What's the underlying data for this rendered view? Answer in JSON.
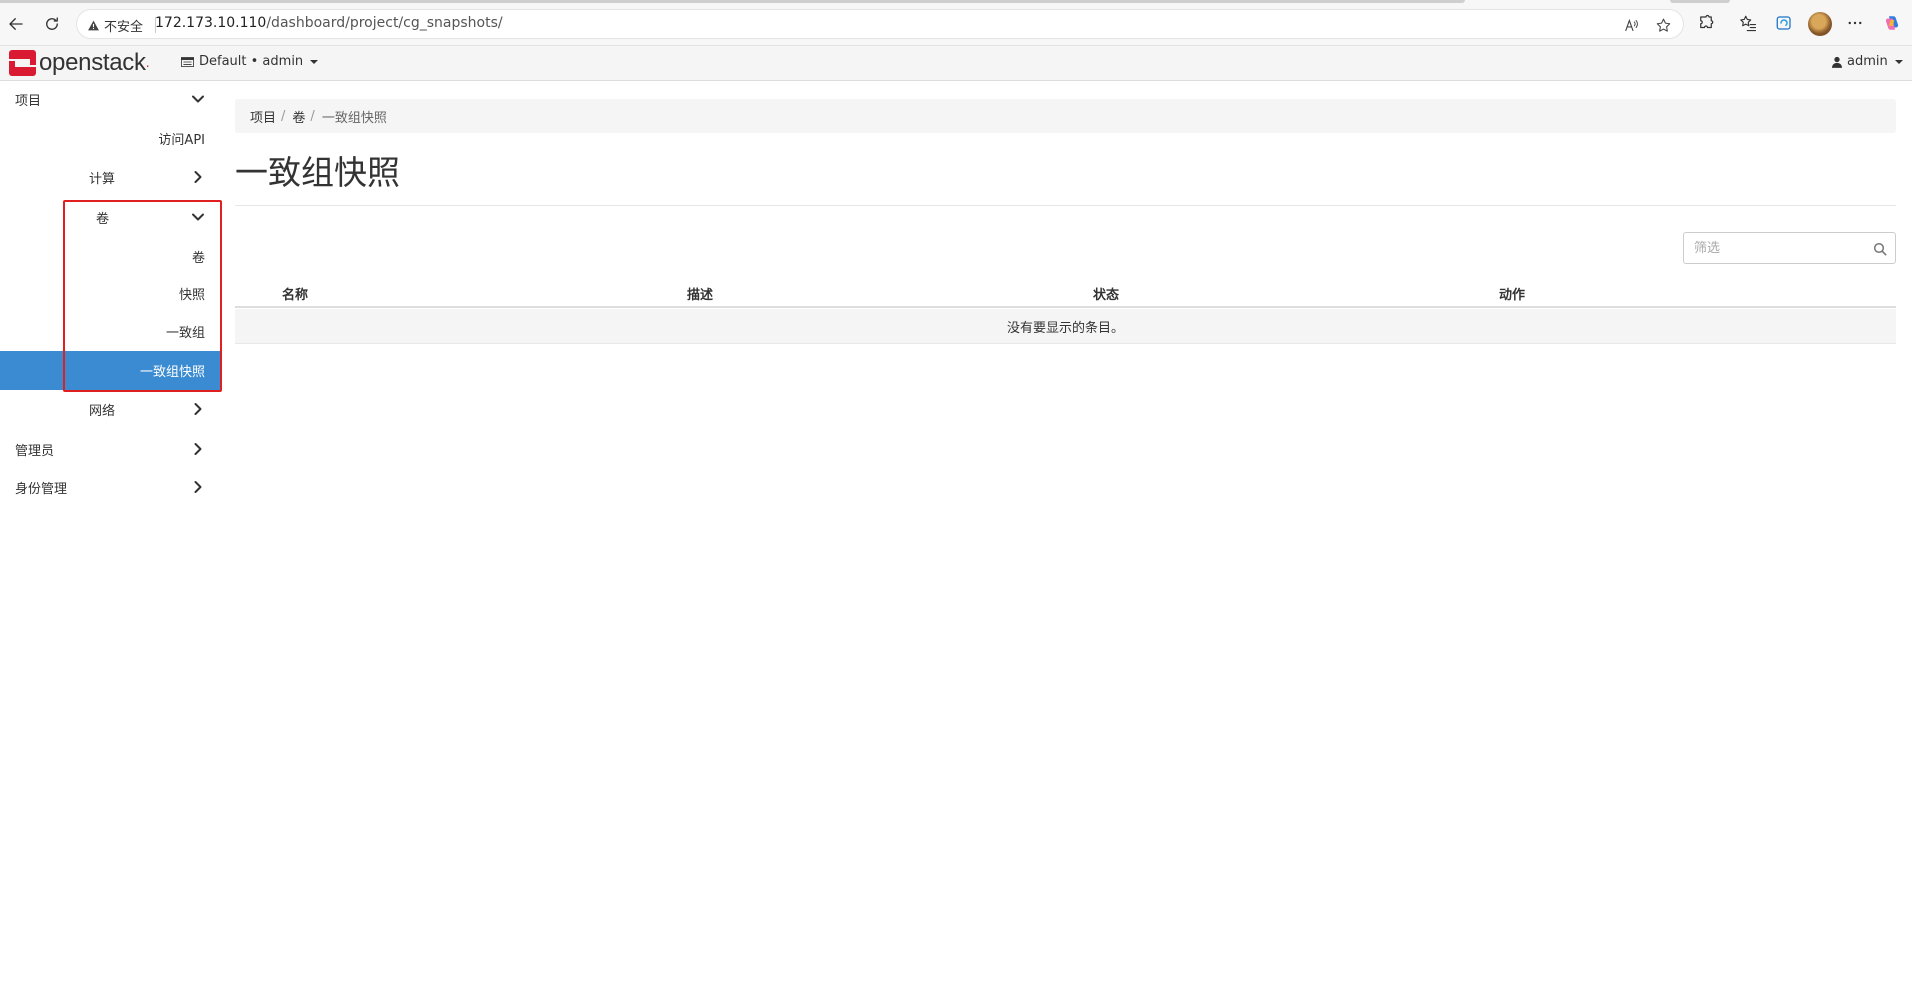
{
  "browser": {
    "security_label": "不安全",
    "url_host": "172.173.10.110",
    "url_path": "/dashboard/project/cg_snapshots/"
  },
  "header": {
    "logo_text": "openstack",
    "logo_dot": ".",
    "project_selector": "Default • admin",
    "user_menu": "admin"
  },
  "sidebar": {
    "project": "项目",
    "access_api": "访问API",
    "compute": "计算",
    "volumes_group": "卷",
    "volumes": "卷",
    "snapshots": "快照",
    "consistency_groups": "一致组",
    "cg_snapshots": "一致组快照",
    "network": "网络",
    "admin": "管理员",
    "identity": "身份管理"
  },
  "breadcrumb": {
    "items": [
      "项目",
      "卷",
      "一致组快照"
    ]
  },
  "page": {
    "title": "一致组快照",
    "filter_placeholder": "筛选"
  },
  "table": {
    "columns": [
      "名称",
      "描述",
      "状态",
      "动作"
    ],
    "empty_message": "没有要显示的条目。"
  },
  "colors": {
    "brand": "#da1a32",
    "active_nav": "#3b8bd3",
    "highlight_box": "#e02020"
  }
}
